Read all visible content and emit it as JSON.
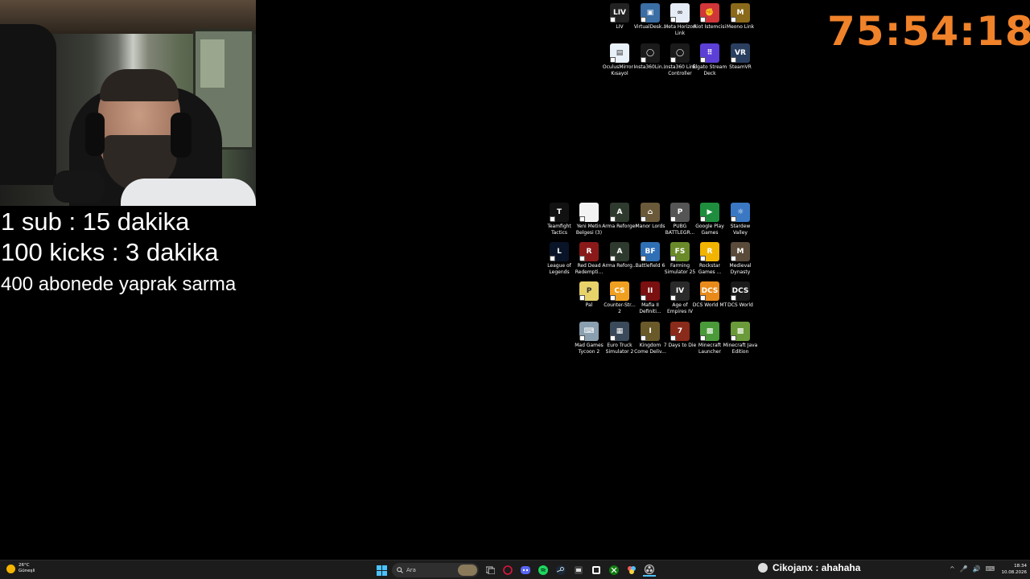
{
  "overlay": {
    "goals": [
      "1 sub : 15 dakika",
      "100 kicks : 3 dakika",
      "400 abonede yaprak sarma"
    ],
    "timer": "75:54:18",
    "timer_color": "#f0822a"
  },
  "desktop_icons": [
    {
      "label": "LIV",
      "glyph": "LIV",
      "bg": "#222222",
      "icon": "liv-icon"
    },
    {
      "label": "VirtualDesk...",
      "glyph": "▣",
      "bg": "#3a6ea5",
      "icon": "virtual-desktop-icon"
    },
    {
      "label": "Meta Horizon Link",
      "glyph": "∞",
      "bg": "#e6ecf5",
      "icon": "meta-horizon-link-icon"
    },
    {
      "label": "Riot İstemcisi",
      "glyph": "✊",
      "bg": "#d13639",
      "icon": "riot-client-icon"
    },
    {
      "label": "Meono Link",
      "glyph": "M",
      "bg": "#8a6a1a",
      "icon": "meono-link-icon"
    },
    {
      "label": "OculusMirror - Kısayol",
      "glyph": "▤",
      "bg": "#e8f0f8",
      "icon": "oculus-mirror-icon"
    },
    {
      "label": "Insta360Lin...",
      "glyph": "◯",
      "bg": "#1a1a1a",
      "icon": "insta360-link-icon"
    },
    {
      "label": "Insta360 Link Controller",
      "glyph": "◯",
      "bg": "#1a1a1a",
      "icon": "insta360-controller-icon"
    },
    {
      "label": "Elgato Stream Deck",
      "glyph": "⠿",
      "bg": "#5b3fd6",
      "icon": "elgato-stream-deck-icon"
    },
    {
      "label": "SteamVR",
      "glyph": "VR",
      "bg": "#2a3f5f",
      "icon": "steamvr-icon"
    },
    {
      "label": "Teamfight Tactics",
      "glyph": "T",
      "bg": "#111111",
      "icon": "teamfight-tactics-icon"
    },
    {
      "label": "Yeni Metin Belgesi (3)",
      "glyph": "",
      "bg": "#f2f2f2",
      "icon": "text-document-icon"
    },
    {
      "label": "Arma Reforger",
      "glyph": "A",
      "bg": "#2f3a2f",
      "icon": "arma-reforger-icon"
    },
    {
      "label": "Manor Lords",
      "glyph": "⌂",
      "bg": "#6a5a3a",
      "icon": "manor-lords-icon"
    },
    {
      "label": "PUBG BATTLEGR...",
      "glyph": "P",
      "bg": "#555555",
      "icon": "pubg-icon"
    },
    {
      "label": "Google Play Games",
      "glyph": "▶",
      "bg": "#1e8e3e",
      "icon": "google-play-games-icon"
    },
    {
      "label": "Stardew Valley",
      "glyph": "☼",
      "bg": "#3a78c4",
      "icon": "stardew-valley-icon"
    },
    {
      "label": "League of Legends",
      "glyph": "L",
      "bg": "#0a1428",
      "icon": "league-of-legends-icon"
    },
    {
      "label": "Red Dead Redempti...",
      "glyph": "R",
      "bg": "#8a1a1a",
      "icon": "red-dead-redemption-icon"
    },
    {
      "label": "Arma Reforg...",
      "glyph": "A",
      "bg": "#2f3a2f",
      "icon": "arma-reforger-2-icon"
    },
    {
      "label": "Battlefield 6",
      "glyph": "BF",
      "bg": "#2f6fb5",
      "icon": "battlefield-6-icon"
    },
    {
      "label": "Farming Simulator 25",
      "glyph": "FS",
      "bg": "#6a8a2a",
      "icon": "farming-simulator-icon"
    },
    {
      "label": "Rockstar Games ...",
      "glyph": "R",
      "bg": "#f3b400",
      "icon": "rockstar-games-icon"
    },
    {
      "label": "Medieval Dynasty",
      "glyph": "M",
      "bg": "#5a4a3a",
      "icon": "medieval-dynasty-icon"
    },
    {
      "label": "Pal",
      "glyph": "P",
      "bg": "#e8d26a",
      "icon": "palworld-icon"
    },
    {
      "label": "Counter-Str... 2",
      "glyph": "CS",
      "bg": "#f0a020",
      "icon": "counter-strike-2-icon"
    },
    {
      "label": "Mafia II Definiti...",
      "glyph": "II",
      "bg": "#7a1010",
      "icon": "mafia-2-icon"
    },
    {
      "label": "Age of Empires IV",
      "glyph": "IV",
      "bg": "#2a2a2a",
      "icon": "age-of-empires-icon"
    },
    {
      "label": "DCS World MT",
      "glyph": "DCS",
      "bg": "#e88a1a",
      "icon": "dcs-world-mt-icon"
    },
    {
      "label": "DCS World",
      "glyph": "DCS",
      "bg": "#1a1a1a",
      "icon": "dcs-world-icon"
    },
    {
      "label": "Mad Games Tycoon 2",
      "glyph": "⌨",
      "bg": "#8aa0b0",
      "icon": "mad-games-tycoon-icon"
    },
    {
      "label": "Euro Truck Simulator 2",
      "glyph": "▦",
      "bg": "#3a4a5a",
      "icon": "euro-truck-simulator-icon"
    },
    {
      "label": "Kingdom Come Deliv...",
      "glyph": "I",
      "bg": "#6a5a2a",
      "icon": "kingdom-come-icon"
    },
    {
      "label": "7 Days to Die",
      "glyph": "7",
      "bg": "#8a2a1a",
      "icon": "7-days-to-die-icon"
    },
    {
      "label": "Minecraft Launcher",
      "glyph": "▩",
      "bg": "#4a9a3a",
      "icon": "minecraft-launcher-icon"
    },
    {
      "label": "Minecraft Java Edition",
      "glyph": "▩",
      "bg": "#6a9a3a",
      "icon": "minecraft-java-icon"
    }
  ],
  "taskbar": {
    "weather_temp": "26°C",
    "weather_desc": "Güneşli",
    "search_placeholder": "Ara",
    "chat_user": "Cikojanx",
    "chat_sep": " : ",
    "chat_message": "ahahaha",
    "time": "18:34",
    "date": "10.08.2026",
    "tray": [
      "^",
      "🎤",
      "🔊",
      "⌨",
      "🔔"
    ]
  }
}
